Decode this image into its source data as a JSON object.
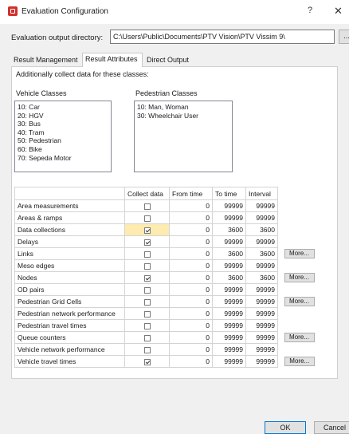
{
  "window": {
    "title": "Evaluation Configuration",
    "help_glyph": "?",
    "close_glyph": "✕",
    "app_icon": "app-logo-icon"
  },
  "output": {
    "label": "Evaluation output directory:",
    "path": "C:\\Users\\Public\\Documents\\PTV Vision\\PTV Vissim 9\\",
    "browse_label": "..."
  },
  "tabs": [
    {
      "label": "Result Management"
    },
    {
      "label": "Result Attributes",
      "active": true
    },
    {
      "label": "Direct Output"
    }
  ],
  "hint": "Additionally collect data for these classes:",
  "vehicle_classes": {
    "label": "Vehicle Classes",
    "items": [
      "10: Car",
      "20: HGV",
      "30: Bus",
      "40: Tram",
      "50: Pedestrian",
      "60: Bike",
      "70: Sepeda Motor"
    ]
  },
  "pedestrian_classes": {
    "label": "Pedestrian Classes",
    "items": [
      "10: Man, Woman",
      "30: Wheelchair User"
    ]
  },
  "table": {
    "headers": [
      "",
      "Collect data",
      "From time",
      "To time",
      "Interval",
      ""
    ],
    "rows": [
      {
        "name": "Area measurements",
        "collect": false,
        "from": "0",
        "to": "99999",
        "interval": "99999",
        "more": ""
      },
      {
        "name": "Areas & ramps",
        "collect": false,
        "from": "0",
        "to": "99999",
        "interval": "99999",
        "more": ""
      },
      {
        "name": "Data collections",
        "collect": true,
        "from": "0",
        "to": "3600",
        "interval": "3600",
        "more": "",
        "highlight": true
      },
      {
        "name": "Delays",
        "collect": true,
        "from": "0",
        "to": "99999",
        "interval": "99999",
        "more": ""
      },
      {
        "name": "Links",
        "collect": false,
        "from": "0",
        "to": "3600",
        "interval": "3600",
        "more": "More..."
      },
      {
        "name": "Meso edges",
        "collect": false,
        "from": "0",
        "to": "99999",
        "interval": "99999",
        "more": ""
      },
      {
        "name": "Nodes",
        "collect": true,
        "from": "0",
        "to": "3600",
        "interval": "3600",
        "more": "More..."
      },
      {
        "name": "OD pairs",
        "collect": false,
        "from": "0",
        "to": "99999",
        "interval": "99999",
        "more": ""
      },
      {
        "name": "Pedestrian Grid Cells",
        "collect": false,
        "from": "0",
        "to": "99999",
        "interval": "99999",
        "more": "More..."
      },
      {
        "name": "Pedestrian network performance",
        "collect": false,
        "from": "0",
        "to": "99999",
        "interval": "99999",
        "more": ""
      },
      {
        "name": "Pedestrian travel times",
        "collect": false,
        "from": "0",
        "to": "99999",
        "interval": "99999",
        "more": ""
      },
      {
        "name": "Queue counters",
        "collect": false,
        "from": "0",
        "to": "99999",
        "interval": "99999",
        "more": "More..."
      },
      {
        "name": "Vehicle network performance",
        "collect": false,
        "from": "0",
        "to": "99999",
        "interval": "99999",
        "more": ""
      },
      {
        "name": "Vehicle travel times",
        "collect": true,
        "from": "0",
        "to": "99999",
        "interval": "99999",
        "more": "More..."
      }
    ]
  },
  "buttons": {
    "ok": "OK",
    "cancel": "Cancel"
  }
}
